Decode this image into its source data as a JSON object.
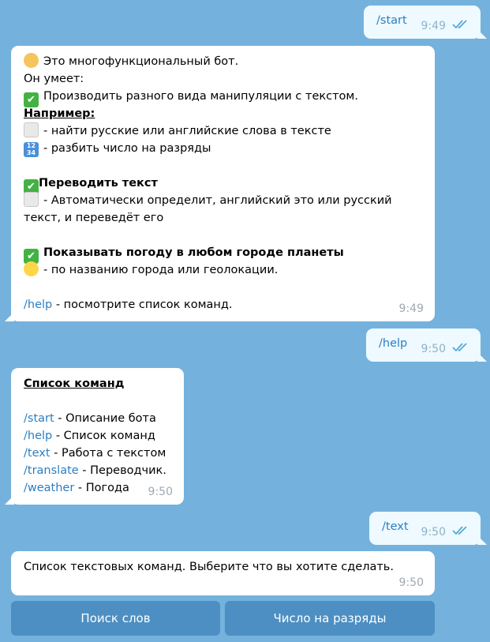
{
  "messages": {
    "m1": {
      "text": "/start",
      "time": "9:49"
    },
    "m2": {
      "lines": {
        "l1": "Это многофункциональный бот.",
        "l2": "Он умеет:",
        "l3": "Производить разного вида манипуляции с текстом.",
        "l4": "Например:",
        "l5": "- найти русские или английские слова в тексте",
        "l6": "- разбить число на разряды",
        "l7": "Переводить текст",
        "l8": "- Автоматически определит, английский это или русский",
        "l9": "текст, и переведёт его",
        "l10": "Показывать погоду в любом городе планеты",
        "l11": "- по названию города или геолокации.",
        "l12_cmd": "/help",
        "l12": "- посмотрите список команд."
      },
      "time": "9:49"
    },
    "m3": {
      "text": "/help",
      "time": "9:50"
    },
    "m4": {
      "title": "Список команд",
      "commands": [
        {
          "cmd": "/start",
          "desc": "- Описание бота"
        },
        {
          "cmd": "/help",
          "desc": "- Список команд"
        },
        {
          "cmd": "/text",
          "desc": "- Работа с текстом"
        },
        {
          "cmd": "/translate",
          "desc": "- Переводчик."
        },
        {
          "cmd": "/weather",
          "desc": "- Погода"
        }
      ],
      "time": "9:50"
    },
    "m5": {
      "text": "/text",
      "time": "9:50"
    },
    "m6": {
      "text": "Список текстовых команд. Выберите что вы хотите сделать.",
      "time": "9:50"
    }
  },
  "keyboard": {
    "btn1": "Поиск слов",
    "btn2": "Число на разряды"
  },
  "icons": {
    "read_ticks": "double-check-icon",
    "check": "check-mark-icon",
    "bot": "person-icon",
    "document": "document-icon",
    "numbers": "numbers-1234-icon",
    "weather": "sun-behind-cloud-icon"
  },
  "colors": {
    "background": "#74b2dd",
    "incoming_bubble": "#ffffff",
    "outgoing_bubble": "#eefaff",
    "command_link": "#2b7ec1",
    "keyboard_button": "#4d8fc2"
  }
}
